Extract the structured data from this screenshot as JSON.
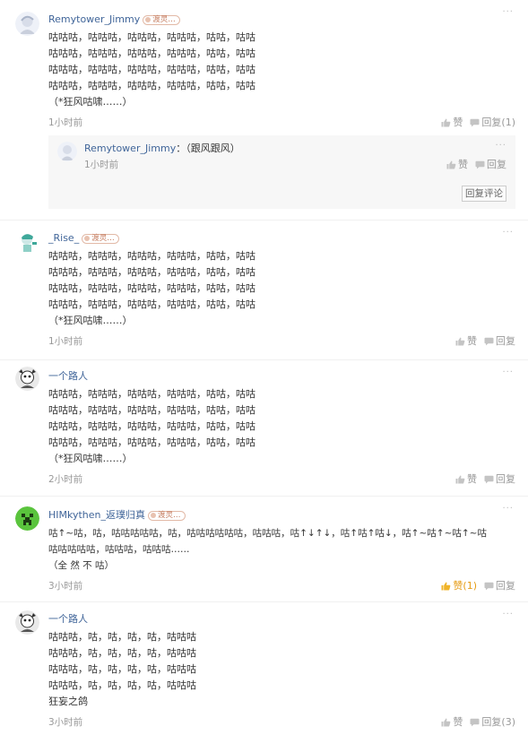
{
  "comments": [
    {
      "author": "Remytower_Jimmy",
      "badge": "渡灵…",
      "text": "咕咕咕，咕咕咕，咕咕咕，咕咕咕，咕咕，咕咕\n咕咕咕，咕咕咕，咕咕咕，咕咕咕，咕咕，咕咕\n咕咕咕，咕咕咕，咕咕咕，咕咕咕，咕咕，咕咕\n咕咕咕，咕咕咕，咕咕咕，咕咕咕，咕咕，咕咕\n（*狂风咕啸……）",
      "time": "1小时前",
      "like_label": "赞",
      "reply_label": "回复(1)",
      "reply": {
        "author": "Remytower_Jimmy",
        "text": "：（跟风跟风）",
        "time": "1小时前",
        "like_label": "赞",
        "reply_label": "回复",
        "reply_comment_button": "回复评论"
      }
    },
    {
      "author": "_Rise_",
      "badge": "渡灵…",
      "text": "咕咕咕，咕咕咕，咕咕咕，咕咕咕，咕咕，咕咕\n咕咕咕，咕咕咕，咕咕咕，咕咕咕，咕咕，咕咕\n咕咕咕，咕咕咕，咕咕咕，咕咕咕，咕咕，咕咕\n咕咕咕，咕咕咕，咕咕咕，咕咕咕，咕咕，咕咕\n（*狂风咕啸……）",
      "time": "1小时前",
      "like_label": "赞",
      "reply_label": "回复"
    },
    {
      "author": "一个路人",
      "text": "咕咕咕，咕咕咕，咕咕咕，咕咕咕，咕咕，咕咕\n咕咕咕，咕咕咕，咕咕咕，咕咕咕，咕咕，咕咕\n咕咕咕，咕咕咕，咕咕咕，咕咕咕，咕咕，咕咕\n咕咕咕，咕咕咕，咕咕咕，咕咕咕，咕咕，咕咕\n（*狂风咕啸……）",
      "time": "2小时前",
      "like_label": "赞",
      "reply_label": "回复"
    },
    {
      "author": "HIMkythen_返璞归真",
      "badge": "渡灵…",
      "text": "咕↑~咕，咕，咕咕咕咕咕，咕，咕咕咕咕咕咕，咕咕咕，咕↑↓↑↓，咕↑咕↑咕↓，咕↑~咕↑~咕↑~咕\n咕咕咕咕咕，咕咕咕，咕咕咕……\n（全 然 不 咕）",
      "time": "3小时前",
      "like_label": "赞(1)",
      "reply_label": "回复"
    },
    {
      "author": "一个路人",
      "text": "咕咕咕，咕，咕，咕，咕，咕咕咕\n咕咕咕，咕，咕，咕，咕，咕咕咕\n咕咕咕，咕，咕，咕，咕，咕咕咕\n咕咕咕，咕，咕，咕，咕，咕咕咕\n狂妄之鸽",
      "time": "3小时前",
      "like_label": "赞",
      "reply_label": "回复(3)"
    }
  ],
  "more_label": "···",
  "icons": {
    "like": "thumbs-up-icon",
    "reply": "speech-bubble-icon",
    "more": "more-dots-icon"
  },
  "colors": {
    "author_link": "#406599",
    "liked": "#e69c15",
    "muted": "#999999",
    "reply_bg": "#f7f7f7"
  }
}
